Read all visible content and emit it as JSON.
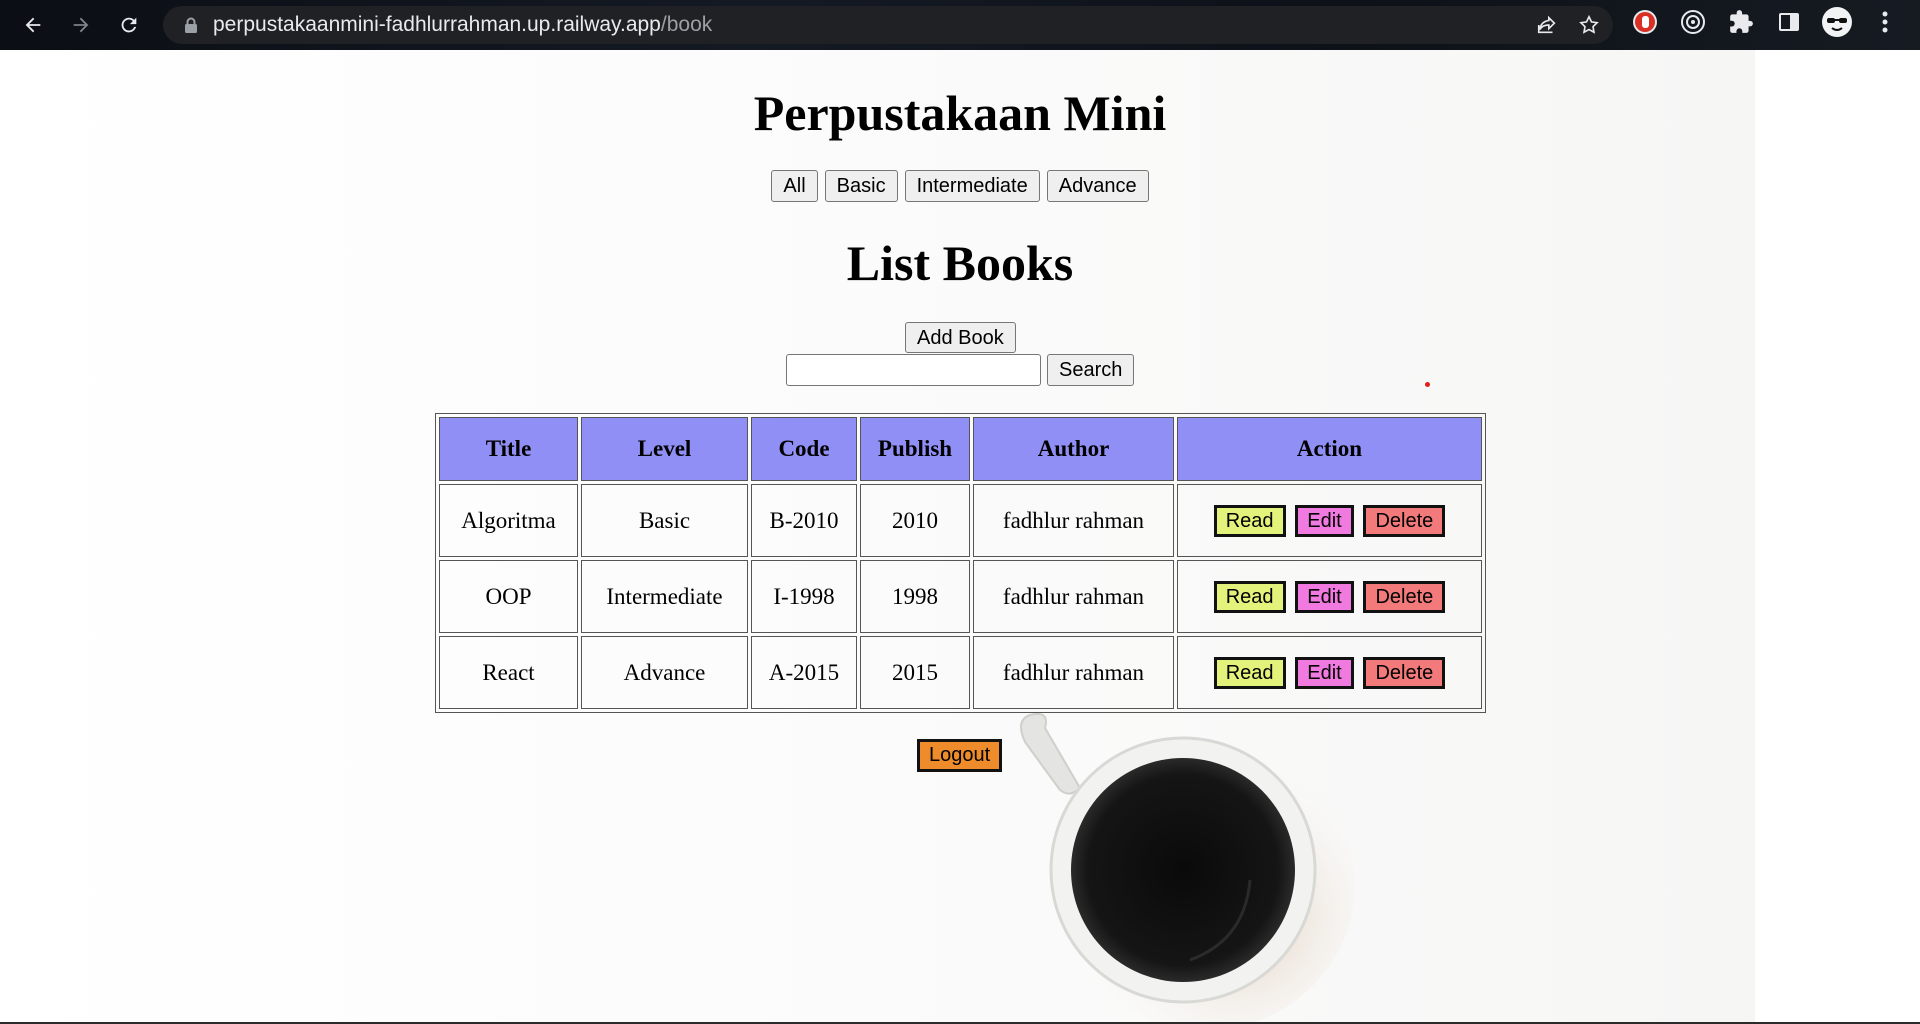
{
  "browser": {
    "url_host": "perpustakaanmini-fadhlurrahman.up.railway.app",
    "url_path": "/book"
  },
  "page": {
    "site_title": "Perpustakaan Mini",
    "filters": [
      "All",
      "Basic",
      "Intermediate",
      "Advance"
    ],
    "list_title": "List Books",
    "add_book_label": "Add Book",
    "search_value": "",
    "search_label": "Search",
    "logout_label": "Logout"
  },
  "table": {
    "headers": [
      "Title",
      "Level",
      "Code",
      "Publish",
      "Author",
      "Action"
    ],
    "rows": [
      {
        "title": "Algoritma",
        "level": "Basic",
        "code": "B-2010",
        "publish": "2010",
        "author": "fadhlur rahman"
      },
      {
        "title": "OOP",
        "level": "Intermediate",
        "code": "I-1998",
        "publish": "1998",
        "author": "fadhlur rahman"
      },
      {
        "title": "React",
        "level": "Advance",
        "code": "A-2015",
        "publish": "2015",
        "author": "fadhlur rahman"
      }
    ],
    "actions": {
      "read": "Read",
      "edit": "Edit",
      "delete": "Delete"
    }
  },
  "colors": {
    "header_bg": "#8f8ff5",
    "read_btn": "#e2f27a",
    "edit_btn": "#f07ae0",
    "delete_btn": "#f27a7a",
    "logout_btn": "#ee8c2c"
  },
  "icons": [
    "back-arrow-icon",
    "forward-arrow-icon",
    "reload-icon",
    "lock-icon",
    "share-icon",
    "star-icon",
    "adblock-icon",
    "target-extension-icon",
    "puzzle-extensions-icon",
    "side-panel-icon",
    "profile-avatar-icon",
    "more-menu-icon"
  ]
}
